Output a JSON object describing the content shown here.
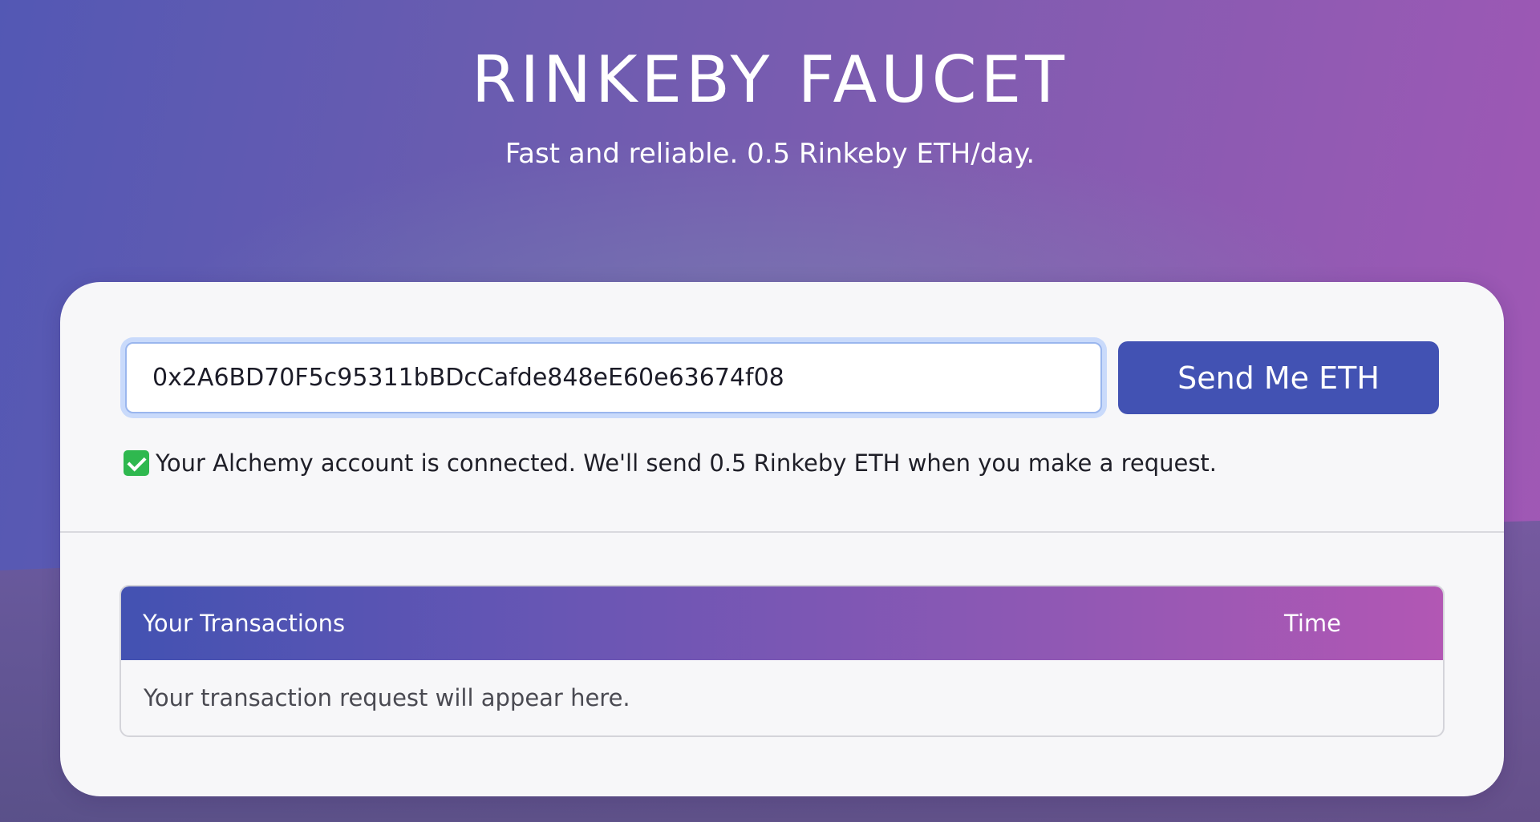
{
  "header": {
    "title": "RINKEBY FAUCET",
    "subtitle": "Fast and reliable. 0.5 Rinkeby ETH/day."
  },
  "form": {
    "address_value": "0x2A6BD70F5c95311bBDcCafde848eE60e63674f08",
    "send_label": "Send Me ETH",
    "status_message": "Your Alchemy account is connected. We'll send 0.5 Rinkeby ETH when you make a request.",
    "status_icon": "check-mark-icon"
  },
  "transactions": {
    "column_main": "Your Transactions",
    "column_time": "Time",
    "empty_message": "Your transaction request will appear here."
  },
  "colors": {
    "button": "#4252b3",
    "success": "#2fb84f",
    "table_header_start": "#4352b2",
    "table_header_end": "#b257b4"
  }
}
